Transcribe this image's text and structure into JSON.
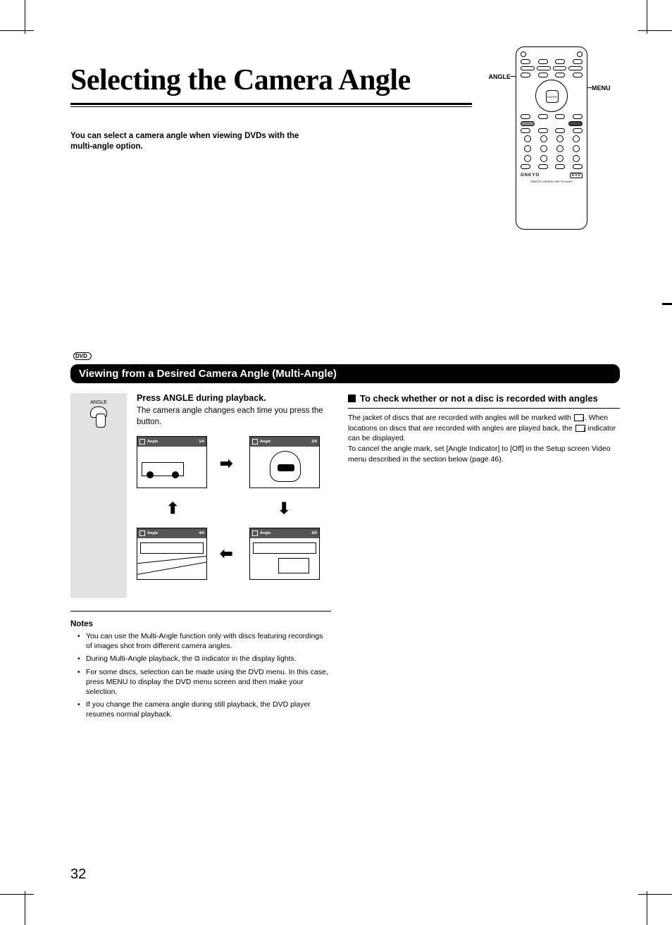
{
  "page_number": "32",
  "title": "Selecting the Camera Angle",
  "intro": "You can select a camera angle when viewing DVDs with the multi-angle option.",
  "remote_callouts": {
    "angle": "ANGLE",
    "menu": "MENU"
  },
  "remote": {
    "brand": "ONKYO",
    "dvd": "DVD",
    "enter": "ENTER",
    "sub": "REMOTE CONTROL UNIT RC-xxxDV"
  },
  "dvd_tag": "DVD",
  "section_bar": "Viewing from a Desired Camera Angle (Multi-Angle)",
  "step": {
    "icon_label": "ANGLE",
    "heading": "Press ANGLE during playback.",
    "body": "The camera angle changes each time you press the button.",
    "frames": {
      "label": "Angle",
      "f1": "1/4",
      "f2": "2/4",
      "f3": "3/4",
      "f4": "4/4"
    }
  },
  "notes_heading": "Notes",
  "notes": [
    "You can use the Multi-Angle function only with discs featuring recordings of images shot from different camera angles.",
    "During Multi-Angle playback, the ⧉ indicator in the display lights.",
    "For some discs, selection can be made using the DVD menu. In this case, press MENU to display the DVD menu screen and then make your selection.",
    "If you change the camera angle during still playback, the DVD player resumes normal playback."
  ],
  "right": {
    "heading": "To check whether or not a disc is recorded with angles",
    "p1a": "The jacket of discs that are recorded with angles will be marked with ",
    "p1b": ". When locations on discs that are recorded with angles are played back, the ",
    "p1c": " indicator can be displayed.",
    "p2": "To cancel the angle mark, set [Angle Indicator] to [Off] in the Setup screen Video menu described in the section below (page 46)."
  }
}
